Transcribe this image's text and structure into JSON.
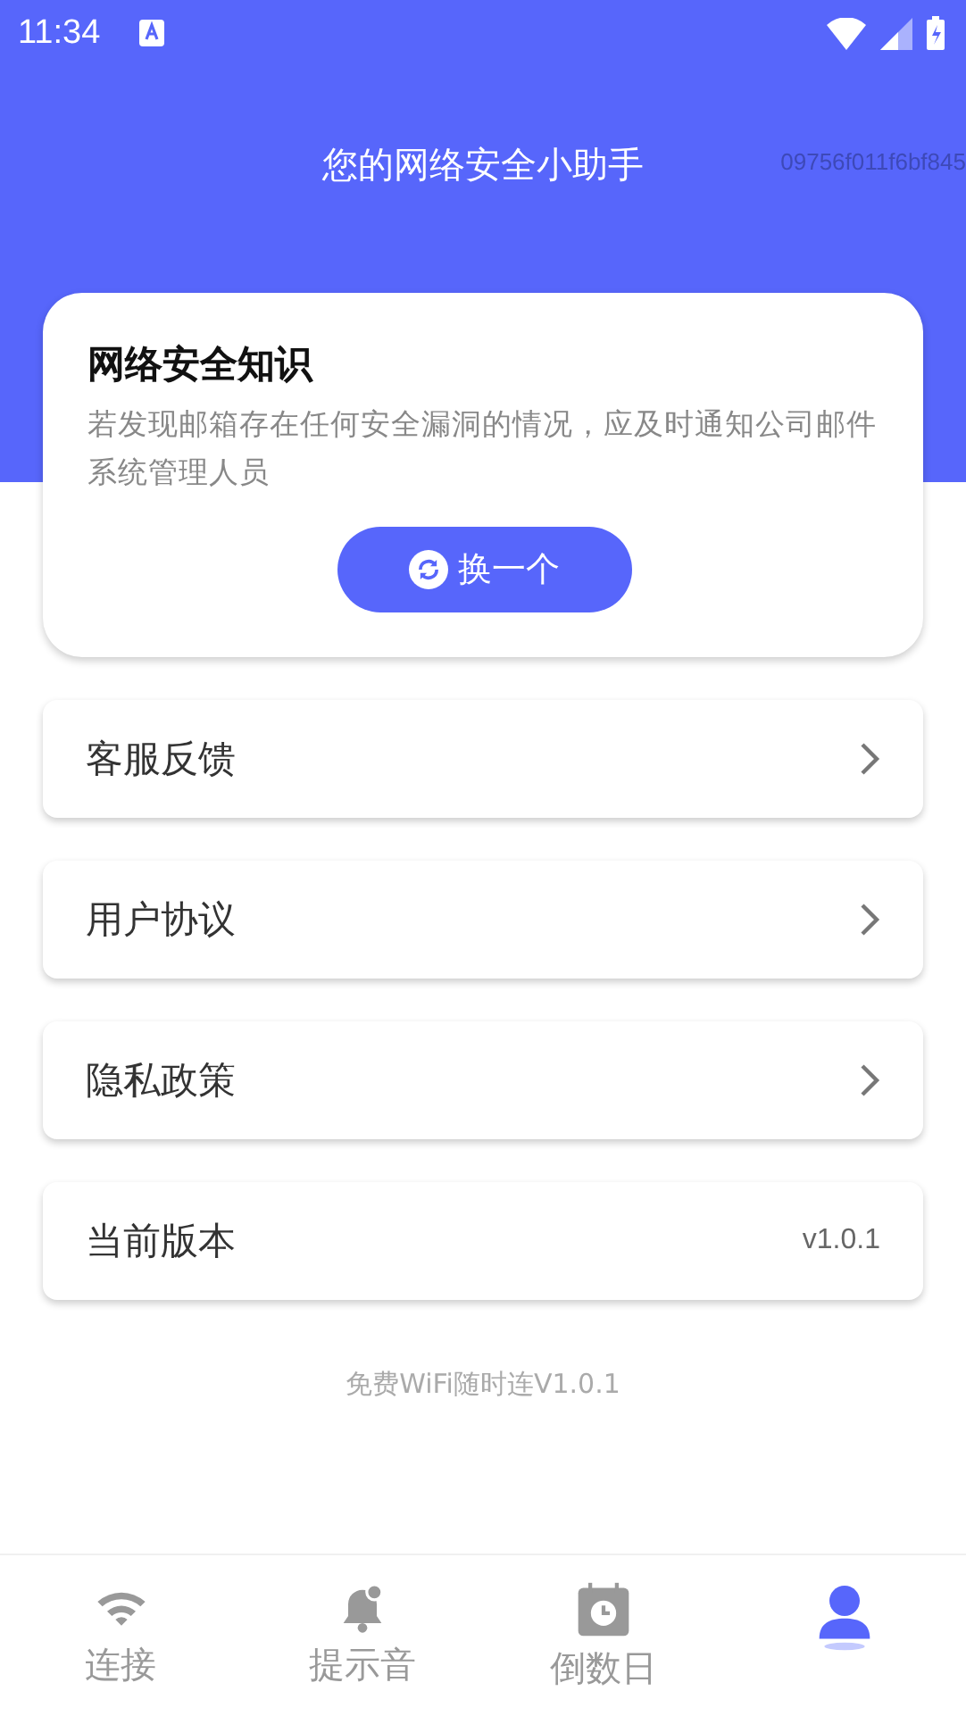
{
  "status_bar": {
    "time": "11:34"
  },
  "header": {
    "title": "您的网络安全小助手",
    "code": "09756f011f6bf845"
  },
  "tip_card": {
    "title": "网络安全知识",
    "text": "若发现邮箱存在任何安全漏洞的情况，应及时通知公司邮件系统管理人员",
    "button": "换一个"
  },
  "menu": [
    {
      "kind": "link",
      "label": "客服反馈"
    },
    {
      "kind": "link",
      "label": "用户协议"
    },
    {
      "kind": "link",
      "label": "隐私政策"
    },
    {
      "kind": "value",
      "label": "当前版本",
      "value": "v1.0.1"
    }
  ],
  "footer": "免费WiFi随时连V1.0.1",
  "tabs": [
    {
      "kind": "wifi",
      "label": "连接",
      "selected": false
    },
    {
      "kind": "bell",
      "label": "提示音",
      "selected": false
    },
    {
      "kind": "calendar",
      "label": "倒数日",
      "selected": false
    },
    {
      "kind": "person",
      "selected": true
    }
  ]
}
